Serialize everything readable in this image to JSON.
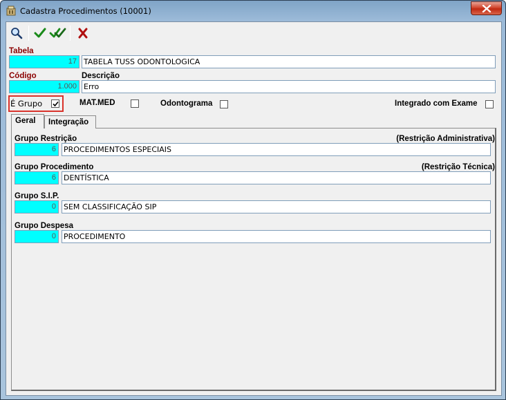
{
  "window": {
    "title": "Cadastra Procedimentos (10001)"
  },
  "toolbar": {
    "search_icon": "magnifier-icon",
    "confirm_icon": "check-icon",
    "confirm_all_icon": "double-check-icon",
    "cancel_icon": "x-icon"
  },
  "form": {
    "tabela_label": "Tabela",
    "tabela_code": "17",
    "tabela_name": "TABELA TUSS ODONTOLOGICA",
    "codigo_label": "Código",
    "codigo_value": "1.000",
    "descricao_label": "Descrição",
    "descricao_value": "Erro",
    "e_grupo_label": "É Grupo",
    "e_grupo_checked": true,
    "matmed_label": "MAT.MED",
    "matmed_checked": false,
    "odontograma_label": "Odontograma",
    "odontograma_checked": false,
    "integrado_label": "Integrado com Exame",
    "integrado_checked": false
  },
  "tabs": [
    {
      "label": "Geral",
      "active": true
    },
    {
      "label": "Integração",
      "active": false
    }
  ],
  "geral": {
    "grupo_restricao_label": "Grupo Restrição",
    "restricao_adm_label": "(Restrição Administrativa)",
    "grupo_restricao_code": "6",
    "grupo_restricao_name": "PROCEDIMENTOS ESPECIAIS",
    "grupo_procedimento_label": "Grupo Procedimento",
    "restricao_tec_label": "(Restrição Técnica)",
    "grupo_procedimento_code": "6",
    "grupo_procedimento_name": "DENTÍSTICA",
    "grupo_sip_label": "Grupo S.I.P.",
    "grupo_sip_code": "0",
    "grupo_sip_name": "SEM CLASSIFICAÇÃO SIP",
    "grupo_despesa_label": "Grupo Despesa",
    "grupo_despesa_code": "0",
    "grupo_despesa_name": "PROCEDIMENTO"
  },
  "colors": {
    "accent_field": "#00ffff",
    "label_red": "#8b0000",
    "highlight": "#d9322a"
  }
}
